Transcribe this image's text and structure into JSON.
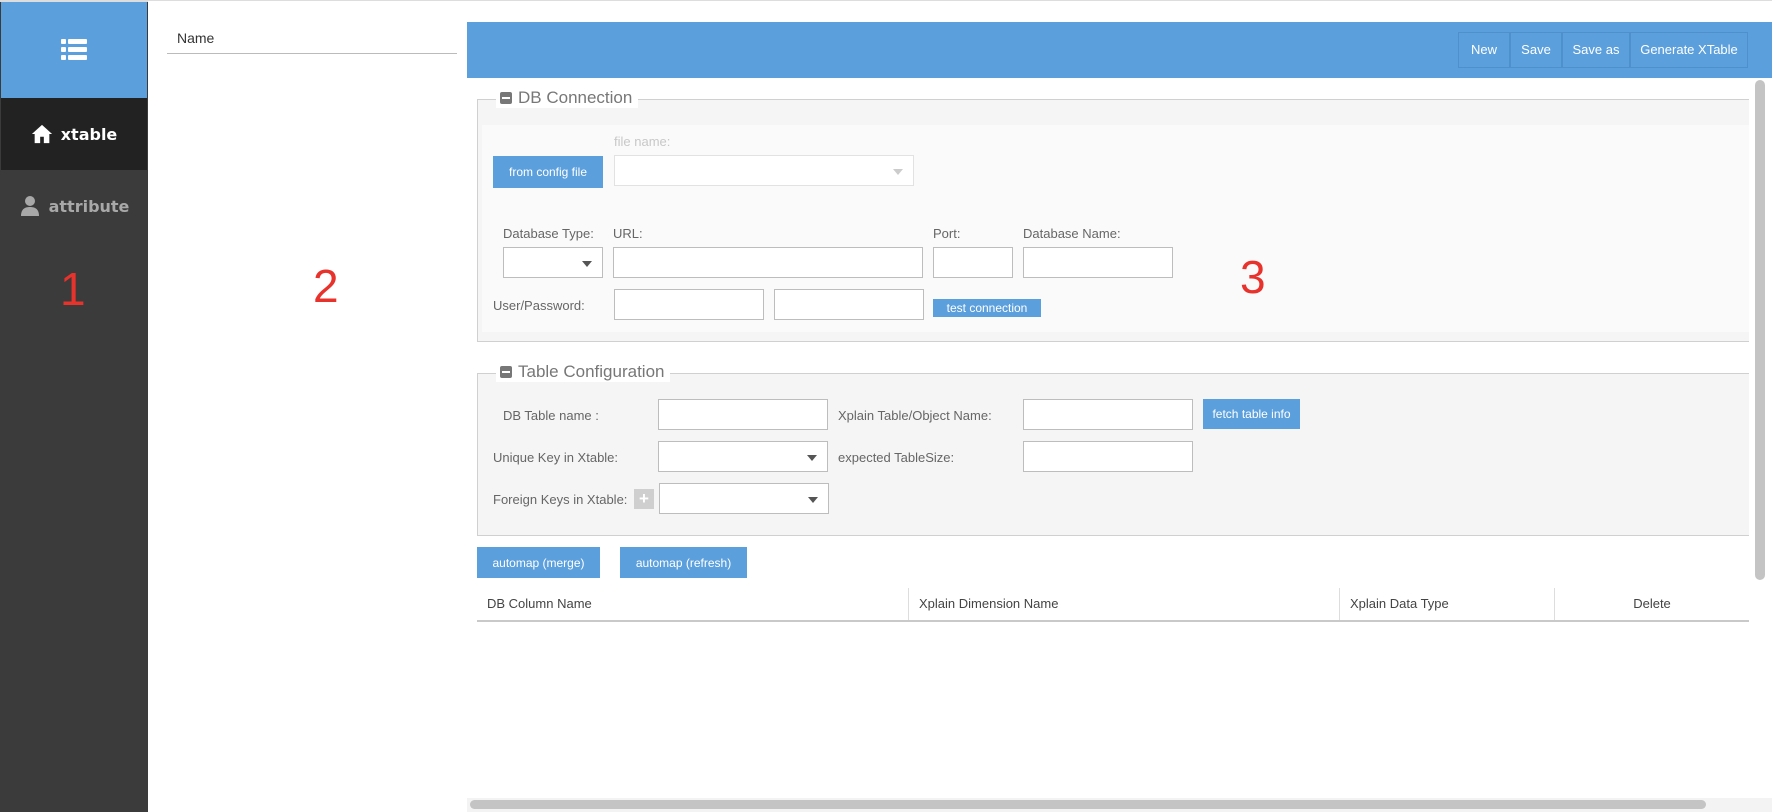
{
  "sidebar": {
    "menu_icon": "list-menu-icon",
    "items": [
      {
        "label": "xtable",
        "icon": "home-icon",
        "active": true
      },
      {
        "label": "attribute",
        "icon": "user-icon",
        "active": false
      }
    ],
    "accent": "#5b9fdc",
    "active_bg": "#222222"
  },
  "annotations": {
    "one": "1",
    "two": "2",
    "three": "3"
  },
  "list_panel": {
    "header": "Name"
  },
  "toolbar": {
    "new_label": "New",
    "save_label": "Save",
    "save_as_label": "Save as",
    "generate_label": "Generate XTable"
  },
  "db_connection": {
    "title": "DB Connection",
    "from_config_label": "from config file",
    "file_name_label": "file name:",
    "db_type_label": "Database Type:",
    "url_label": "URL:",
    "port_label": "Port:",
    "db_name_label": "Database Name:",
    "user_password_label": "User/Password:",
    "test_connection_label": "test connection"
  },
  "table_config": {
    "title": "Table Configuration",
    "db_table_label": "DB Table name :",
    "xplain_table_label": "Xplain Table/Object Name:",
    "fetch_label": "fetch table info",
    "unique_key_label": "Unique Key in Xtable:",
    "expected_size_label": "expected TableSize:",
    "foreign_keys_label": "Foreign Keys in Xtable:"
  },
  "automap": {
    "merge_label": "automap (merge)",
    "refresh_label": "automap (refresh)"
  },
  "grid": {
    "columns": [
      "DB Column Name",
      "Xplain Dimension Name",
      "Xplain Data Type",
      "Delete"
    ],
    "rows": []
  }
}
